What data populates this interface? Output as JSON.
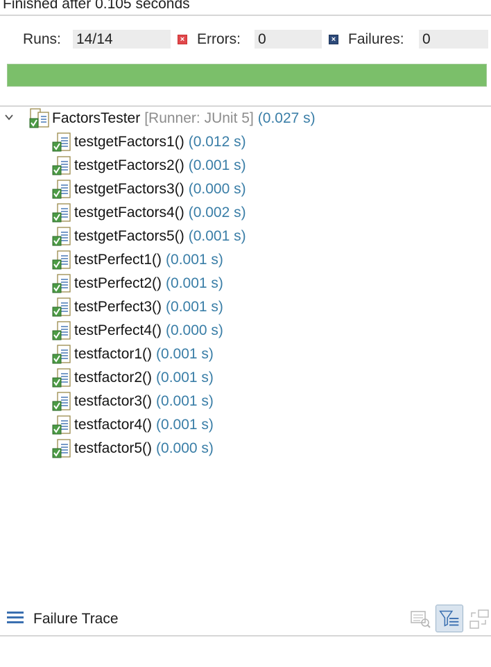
{
  "status": {
    "finished_text": "Finished after 0.105 seconds"
  },
  "counters": {
    "runs_label": "Runs:",
    "runs_value": "14/14",
    "errors_label": "Errors:",
    "errors_value": "0",
    "failures_label": "Failures:",
    "failures_value": "0"
  },
  "progress": {
    "fraction": 1.0,
    "color": "#7bbf6a"
  },
  "tree": {
    "root": {
      "name": "FactorsTester",
      "runner": "[Runner: JUnit 5]",
      "time": "(0.027 s)"
    },
    "tests": [
      {
        "name": "testgetFactors1()",
        "time": "(0.012 s)"
      },
      {
        "name": "testgetFactors2()",
        "time": "(0.001 s)"
      },
      {
        "name": "testgetFactors3()",
        "time": "(0.000 s)"
      },
      {
        "name": "testgetFactors4()",
        "time": "(0.002 s)"
      },
      {
        "name": "testgetFactors5()",
        "time": "(0.001 s)"
      },
      {
        "name": "testPerfect1()",
        "time": "(0.001 s)"
      },
      {
        "name": "testPerfect2()",
        "time": "(0.001 s)"
      },
      {
        "name": "testPerfect3()",
        "time": "(0.001 s)"
      },
      {
        "name": "testPerfect4()",
        "time": "(0.000 s)"
      },
      {
        "name": "testfactor1()",
        "time": "(0.001 s)"
      },
      {
        "name": "testfactor2()",
        "time": "(0.001 s)"
      },
      {
        "name": "testfactor3()",
        "time": "(0.001 s)"
      },
      {
        "name": "testfactor4()",
        "time": "(0.001 s)"
      },
      {
        "name": "testfactor5()",
        "time": "(0.000 s)"
      }
    ]
  },
  "failure_trace": {
    "label": "Failure Trace"
  },
  "icons": {
    "chevron": "chevron-down-icon",
    "suite": "test-suite-ok-icon",
    "test": "test-ok-icon",
    "error": "error-icon",
    "failure": "failure-icon",
    "trace": "stack-trace-icon",
    "compare": "compare-results-icon",
    "filter": "filter-stack-icon",
    "layout": "toggle-layout-icon"
  }
}
